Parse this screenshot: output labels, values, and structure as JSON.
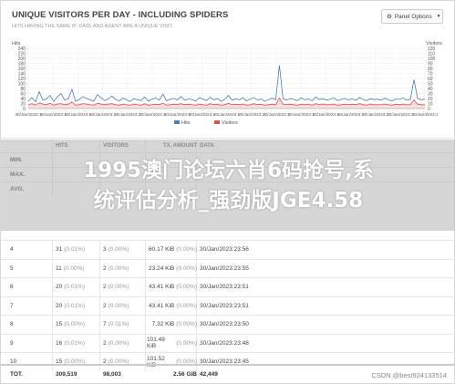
{
  "panel": {
    "title": "UNIQUE VISITORS PER DAY - INCLUDING SPIDERS",
    "subtitle": "HITS HAVING THE SAME IP, DATE AND AGENT ARE A UNIQUE VISIT.",
    "options_label": "Panel Options"
  },
  "overlay": {
    "line1": "1995澳门论坛六肖6码抢号,系",
    "line2": "统评估分析_强劲版JGE4.58"
  },
  "watermark": "CSDN @best924133514",
  "chart_data": {
    "type": "line",
    "left_axis_label": "Hits",
    "right_axis_label": "Visitors",
    "left_ticks": [
      "240",
      "220",
      "200",
      "180",
      "160",
      "140",
      "120",
      "100",
      "80",
      "60",
      "40",
      "20",
      "0"
    ],
    "right_ticks": [
      "120",
      "110",
      "100",
      "90",
      "80",
      "70",
      "60",
      "50",
      "40",
      "30",
      "20",
      "10",
      "0"
    ],
    "ylim_left": [
      0,
      250
    ],
    "ylim_right": [
      0,
      125
    ],
    "x_tick_labels": [
      "30/Jan/2023:1",
      "30/Jan/2023:1",
      "30/Jan/2023:1",
      "30/Jan/2023:1",
      "30/Jan/2023:1",
      "30/Jan/2023:1",
      "30/Jan/2023:1",
      "30/Jan/2023:1",
      "30/Jan/2023:1",
      "30/Jan/2023:1",
      "30/Jan/2023:1",
      "30/Jan/2023:1",
      "30/Jan/2023:1",
      "30/Jan/2023:1",
      "30/Jan/2023:1",
      "30/Jan/2023:1",
      "30/Jan/2023:1"
    ],
    "series": [
      {
        "name": "Hits",
        "color": "#4a7fb5",
        "values": [
          30,
          45,
          28,
          70,
          35,
          40,
          55,
          30,
          48,
          62,
          35,
          40,
          80,
          30,
          38,
          50,
          42,
          36,
          30,
          58,
          45,
          33,
          40,
          52,
          38,
          31,
          44,
          36,
          29,
          41,
          37,
          33,
          48,
          30,
          39,
          44,
          35,
          60,
          32,
          38,
          42,
          36,
          50,
          34,
          40,
          37,
          31,
          45,
          39,
          33,
          47,
          36,
          42,
          30,
          38,
          55,
          34,
          41,
          36,
          44,
          32,
          39,
          46,
          35,
          40,
          30,
          37,
          43,
          36,
          180,
          40,
          35,
          42,
          38,
          33,
          45,
          36,
          40,
          32,
          48,
          37,
          41,
          35,
          39,
          44,
          33,
          38,
          42,
          36,
          40,
          34,
          46,
          38,
          33,
          41,
          37,
          39,
          35,
          43,
          36,
          31,
          40,
          38,
          44,
          35,
          37,
          120,
          42,
          36,
          39
        ]
      },
      {
        "name": "Visitors",
        "color": "#d9534f",
        "values": [
          8,
          10,
          7,
          12,
          9,
          8,
          11,
          7,
          9,
          10,
          8,
          9,
          14,
          7,
          8,
          10,
          9,
          8,
          7,
          11,
          9,
          8,
          9,
          10,
          8,
          7,
          9,
          8,
          7,
          9,
          8,
          7,
          10,
          7,
          8,
          9,
          8,
          11,
          7,
          8,
          9,
          8,
          10,
          8,
          9,
          8,
          7,
          9,
          8,
          7,
          10,
          8,
          9,
          7,
          8,
          11,
          8,
          9,
          8,
          9,
          7,
          8,
          10,
          8,
          9,
          7,
          8,
          9,
          8,
          22,
          9,
          8,
          9,
          8,
          7,
          9,
          8,
          9,
          7,
          10,
          8,
          9,
          8,
          8,
          9,
          7,
          8,
          9,
          8,
          9,
          8,
          10,
          8,
          7,
          9,
          8,
          8,
          8,
          9,
          8,
          7,
          9,
          8,
          9,
          8,
          8,
          18,
          9,
          8,
          8
        ]
      }
    ],
    "legend": [
      "Hits",
      "Visitors"
    ],
    "legend_position": "bottom-left"
  },
  "table": {
    "headers": [
      "HITS",
      "VISITORS",
      "TX. AMOUNT",
      "DATA"
    ],
    "summary_rows": [
      {
        "label": "MIN."
      },
      {
        "label": "MAX."
      },
      {
        "label": "AVG."
      }
    ],
    "rows": [
      {
        "id": "4",
        "hits": "31",
        "hits_pct": "(0.01%)",
        "visitors": "3",
        "visitors_pct": "(0.00%)",
        "tx": "60.17 KiB",
        "tx_pct": "(0.00%)",
        "data": "30/Jan/2023:23:56"
      },
      {
        "id": "5",
        "hits": "11",
        "hits_pct": "(0.00%)",
        "visitors": "2",
        "visitors_pct": "(0.00%)",
        "tx": "23.24 KiB",
        "tx_pct": "(0.00%)",
        "data": "30/Jan/2023:23:55"
      },
      {
        "id": "6",
        "hits": "20",
        "hits_pct": "(0.01%)",
        "visitors": "2",
        "visitors_pct": "(0.00%)",
        "tx": "43.41 KiB",
        "tx_pct": "(0.00%)",
        "data": "30/Jan/2023:23:51"
      },
      {
        "id": "7",
        "hits": "20",
        "hits_pct": "(0.01%)",
        "visitors": "2",
        "visitors_pct": "(0.00%)",
        "tx": "43.41 KiB",
        "tx_pct": "(0.00%)",
        "data": "30/Jan/2023:23:51"
      },
      {
        "id": "8",
        "hits": "15",
        "hits_pct": "(0.00%)",
        "visitors": "7",
        "visitors_pct": "(0.01%)",
        "tx": "7.32 KiB",
        "tx_pct": "(0.00%)",
        "data": "30/Jan/2023:23:50"
      },
      {
        "id": "9",
        "hits": "16",
        "hits_pct": "(0.01%)",
        "visitors": "2",
        "visitors_pct": "(0.00%)",
        "tx": "101.49 KiB",
        "tx_pct": "(0.00%)",
        "data": "30/Jan/2023:23:48"
      },
      {
        "id": "10",
        "hits": "15",
        "hits_pct": "(0.00%)",
        "visitors": "2",
        "visitors_pct": "(0.00%)",
        "tx": "101.52 KiB",
        "tx_pct": "(0.00%)",
        "data": "30/Jan/2023:23:45"
      }
    ],
    "total": {
      "label": "TOT.",
      "hits": "309,519",
      "visitors": "98,003",
      "tx": "2.56 GiB",
      "data": "42,449"
    }
  }
}
